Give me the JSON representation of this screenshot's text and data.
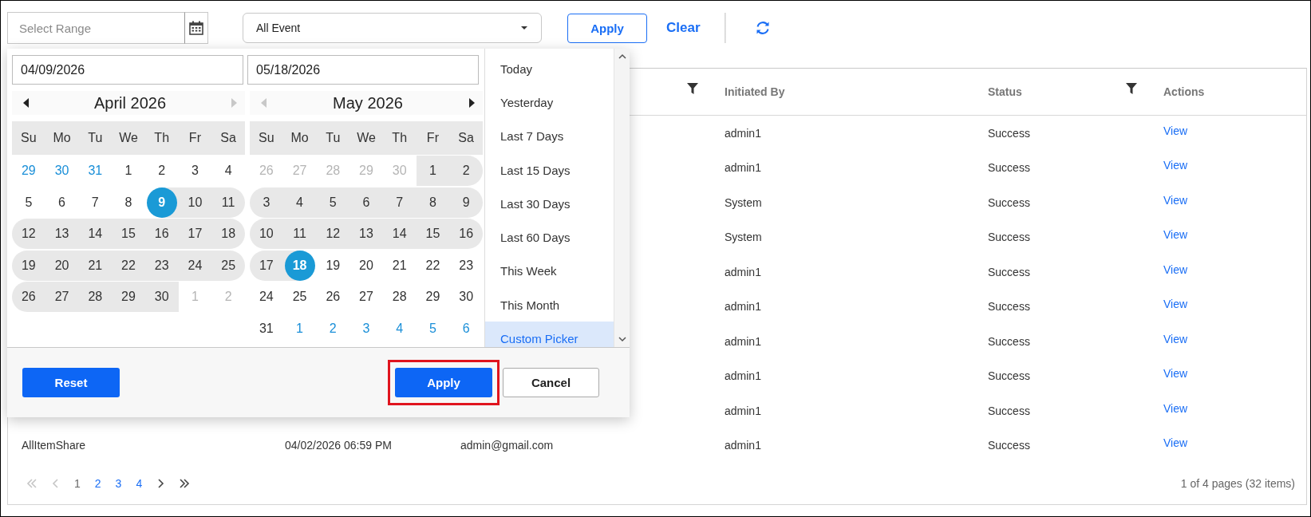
{
  "toolbar": {
    "range_field": {
      "placeholder": "Select Range"
    },
    "event_select": {
      "value": "All Event"
    },
    "apply": "Apply",
    "clear": "Clear"
  },
  "table": {
    "columns": [
      {
        "filter": true
      },
      {
        "label": "Initiated By",
        "filter": false
      },
      {
        "label": "Status",
        "filter": true
      },
      {
        "label": "Actions",
        "filter": false
      }
    ],
    "rows": [
      {
        "initiated_by": "admin1",
        "status": "Success",
        "action": "View"
      },
      {
        "initiated_by": "admin1",
        "status": "Success",
        "action": "View"
      },
      {
        "initiated_by": "System",
        "status": "Success",
        "action": "View"
      },
      {
        "initiated_by": "System",
        "status": "Success",
        "action": "View"
      },
      {
        "initiated_by": "admin1",
        "status": "Success",
        "action": "View"
      },
      {
        "initiated_by": "admin1",
        "status": "Success",
        "action": "View"
      },
      {
        "initiated_by": "admin1",
        "status": "Success",
        "action": "View"
      },
      {
        "initiated_by": "admin1",
        "status": "Success",
        "action": "View"
      },
      {
        "initiated_by": "admin1",
        "status": "Success",
        "action": "View"
      },
      {
        "name": "AllItemShare",
        "date": "04/02/2026 06:59 PM",
        "email": "admin@gmail.com",
        "initiated_by": "admin1",
        "status": "Success",
        "action": "View"
      }
    ],
    "pagination": {
      "first_disabled": true,
      "prev_disabled": true,
      "next_disabled": false,
      "last_disabled": false,
      "pages": [
        {
          "label": "1",
          "selected": true
        },
        {
          "label": "2",
          "selected": false
        },
        {
          "label": "3",
          "selected": false
        },
        {
          "label": "4",
          "selected": false
        }
      ],
      "info": "1 of 4 pages (32 items)"
    }
  },
  "date_picker": {
    "start_value": "04/09/2026",
    "end_value": "05/18/2026",
    "calendars": [
      {
        "title": "April 2026",
        "prev_disabled": false,
        "next_disabled": true,
        "weekdays": [
          "Su",
          "Mo",
          "Tu",
          "We",
          "Th",
          "Fr",
          "Sa"
        ],
        "weeks": [
          [
            {
              "label": "29",
              "other_month": true,
              "disabled": false,
              "in_range": false,
              "selected": false
            },
            {
              "label": "30",
              "other_month": true,
              "disabled": false,
              "in_range": false,
              "selected": false
            },
            {
              "label": "31",
              "other_month": true,
              "disabled": false,
              "in_range": false,
              "selected": false
            },
            {
              "label": "1",
              "other_month": false,
              "disabled": false,
              "in_range": false,
              "selected": false
            },
            {
              "label": "2",
              "other_month": false,
              "disabled": false,
              "in_range": false,
              "selected": false
            },
            {
              "label": "3",
              "other_month": false,
              "disabled": false,
              "in_range": false,
              "selected": false
            },
            {
              "label": "4",
              "other_month": false,
              "disabled": false,
              "in_range": false,
              "selected": false
            }
          ],
          [
            {
              "label": "5",
              "other_month": false,
              "disabled": false,
              "in_range": false,
              "selected": false
            },
            {
              "label": "6",
              "other_month": false,
              "disabled": false,
              "in_range": false,
              "selected": false
            },
            {
              "label": "7",
              "other_month": false,
              "disabled": false,
              "in_range": false,
              "selected": false
            },
            {
              "label": "8",
              "other_month": false,
              "disabled": false,
              "in_range": false,
              "selected": false
            },
            {
              "label": "9",
              "other_month": false,
              "disabled": false,
              "in_range": true,
              "selected": true
            },
            {
              "label": "10",
              "other_month": false,
              "disabled": false,
              "in_range": true,
              "selected": false
            },
            {
              "label": "11",
              "other_month": false,
              "disabled": false,
              "in_range": true,
              "selected": false
            }
          ],
          [
            {
              "label": "12",
              "other_month": false,
              "disabled": false,
              "in_range": true,
              "selected": false
            },
            {
              "label": "13",
              "other_month": false,
              "disabled": false,
              "in_range": true,
              "selected": false
            },
            {
              "label": "14",
              "other_month": false,
              "disabled": false,
              "in_range": true,
              "selected": false
            },
            {
              "label": "15",
              "other_month": false,
              "disabled": false,
              "in_range": true,
              "selected": false
            },
            {
              "label": "16",
              "other_month": false,
              "disabled": false,
              "in_range": true,
              "selected": false
            },
            {
              "label": "17",
              "other_month": false,
              "disabled": false,
              "in_range": true,
              "selected": false
            },
            {
              "label": "18",
              "other_month": false,
              "disabled": false,
              "in_range": true,
              "selected": false
            }
          ],
          [
            {
              "label": "19",
              "other_month": false,
              "disabled": false,
              "in_range": true,
              "selected": false
            },
            {
              "label": "20",
              "other_month": false,
              "disabled": false,
              "in_range": true,
              "selected": false
            },
            {
              "label": "21",
              "other_month": false,
              "disabled": false,
              "in_range": true,
              "selected": false
            },
            {
              "label": "22",
              "other_month": false,
              "disabled": false,
              "in_range": true,
              "selected": false
            },
            {
              "label": "23",
              "other_month": false,
              "disabled": false,
              "in_range": true,
              "selected": false
            },
            {
              "label": "24",
              "other_month": false,
              "disabled": false,
              "in_range": true,
              "selected": false
            },
            {
              "label": "25",
              "other_month": false,
              "disabled": false,
              "in_range": true,
              "selected": false
            }
          ],
          [
            {
              "label": "26",
              "other_month": false,
              "disabled": false,
              "in_range": true,
              "selected": false
            },
            {
              "label": "27",
              "other_month": false,
              "disabled": false,
              "in_range": true,
              "selected": false
            },
            {
              "label": "28",
              "other_month": false,
              "disabled": false,
              "in_range": true,
              "selected": false
            },
            {
              "label": "29",
              "other_month": false,
              "disabled": false,
              "in_range": true,
              "selected": false
            },
            {
              "label": "30",
              "other_month": false,
              "disabled": false,
              "in_range": true,
              "selected": false
            },
            {
              "label": "1",
              "other_month": true,
              "disabled": true,
              "in_range": false,
              "selected": false
            },
            {
              "label": "2",
              "other_month": true,
              "disabled": true,
              "in_range": false,
              "selected": false
            }
          ]
        ]
      },
      {
        "title": "May 2026",
        "prev_disabled": true,
        "next_disabled": false,
        "weekdays": [
          "Su",
          "Mo",
          "Tu",
          "We",
          "Th",
          "Fr",
          "Sa"
        ],
        "weeks": [
          [
            {
              "label": "26",
              "other_month": true,
              "disabled": true,
              "in_range": false,
              "selected": false
            },
            {
              "label": "27",
              "other_month": true,
              "disabled": true,
              "in_range": false,
              "selected": false
            },
            {
              "label": "28",
              "other_month": true,
              "disabled": true,
              "in_range": false,
              "selected": false
            },
            {
              "label": "29",
              "other_month": true,
              "disabled": true,
              "in_range": false,
              "selected": false
            },
            {
              "label": "30",
              "other_month": true,
              "disabled": true,
              "in_range": false,
              "selected": false
            },
            {
              "label": "1",
              "other_month": false,
              "disabled": false,
              "in_range": true,
              "selected": false
            },
            {
              "label": "2",
              "other_month": false,
              "disabled": false,
              "in_range": true,
              "selected": false
            }
          ],
          [
            {
              "label": "3",
              "other_month": false,
              "disabled": false,
              "in_range": true,
              "selected": false
            },
            {
              "label": "4",
              "other_month": false,
              "disabled": false,
              "in_range": true,
              "selected": false
            },
            {
              "label": "5",
              "other_month": false,
              "disabled": false,
              "in_range": true,
              "selected": false
            },
            {
              "label": "6",
              "other_month": false,
              "disabled": false,
              "in_range": true,
              "selected": false
            },
            {
              "label": "7",
              "other_month": false,
              "disabled": false,
              "in_range": true,
              "selected": false
            },
            {
              "label": "8",
              "other_month": false,
              "disabled": false,
              "in_range": true,
              "selected": false
            },
            {
              "label": "9",
              "other_month": false,
              "disabled": false,
              "in_range": true,
              "selected": false
            }
          ],
          [
            {
              "label": "10",
              "other_month": false,
              "disabled": false,
              "in_range": true,
              "selected": false
            },
            {
              "label": "11",
              "other_month": false,
              "disabled": false,
              "in_range": true,
              "selected": false
            },
            {
              "label": "12",
              "other_month": false,
              "disabled": false,
              "in_range": true,
              "selected": false
            },
            {
              "label": "13",
              "other_month": false,
              "disabled": false,
              "in_range": true,
              "selected": false
            },
            {
              "label": "14",
              "other_month": false,
              "disabled": false,
              "in_range": true,
              "selected": false
            },
            {
              "label": "15",
              "other_month": false,
              "disabled": false,
              "in_range": true,
              "selected": false
            },
            {
              "label": "16",
              "other_month": false,
              "disabled": false,
              "in_range": true,
              "selected": false
            }
          ],
          [
            {
              "label": "17",
              "other_month": false,
              "disabled": false,
              "in_range": true,
              "selected": false
            },
            {
              "label": "18",
              "other_month": false,
              "disabled": false,
              "in_range": true,
              "selected": true
            },
            {
              "label": "19",
              "other_month": false,
              "disabled": false,
              "in_range": false,
              "selected": false
            },
            {
              "label": "20",
              "other_month": false,
              "disabled": false,
              "in_range": false,
              "selected": false
            },
            {
              "label": "21",
              "other_month": false,
              "disabled": false,
              "in_range": false,
              "selected": false
            },
            {
              "label": "22",
              "other_month": false,
              "disabled": false,
              "in_range": false,
              "selected": false
            },
            {
              "label": "23",
              "other_month": false,
              "disabled": false,
              "in_range": false,
              "selected": false
            }
          ],
          [
            {
              "label": "24",
              "other_month": false,
              "disabled": false,
              "in_range": false,
              "selected": false
            },
            {
              "label": "25",
              "other_month": false,
              "disabled": false,
              "in_range": false,
              "selected": false
            },
            {
              "label": "26",
              "other_month": false,
              "disabled": false,
              "in_range": false,
              "selected": false
            },
            {
              "label": "27",
              "other_month": false,
              "disabled": false,
              "in_range": false,
              "selected": false
            },
            {
              "label": "28",
              "other_month": false,
              "disabled": false,
              "in_range": false,
              "selected": false
            },
            {
              "label": "29",
              "other_month": false,
              "disabled": false,
              "in_range": false,
              "selected": false
            },
            {
              "label": "30",
              "other_month": false,
              "disabled": false,
              "in_range": false,
              "selected": false
            }
          ],
          [
            {
              "label": "31",
              "other_month": false,
              "disabled": false,
              "in_range": false,
              "selected": false
            },
            {
              "label": "1",
              "other_month": true,
              "disabled": false,
              "in_range": false,
              "selected": false
            },
            {
              "label": "2",
              "other_month": true,
              "disabled": false,
              "in_range": false,
              "selected": false
            },
            {
              "label": "3",
              "other_month": true,
              "disabled": false,
              "in_range": false,
              "selected": false
            },
            {
              "label": "4",
              "other_month": true,
              "disabled": false,
              "in_range": false,
              "selected": false
            },
            {
              "label": "5",
              "other_month": true,
              "disabled": false,
              "in_range": false,
              "selected": false
            },
            {
              "label": "6",
              "other_month": true,
              "disabled": false,
              "in_range": false,
              "selected": false
            }
          ]
        ]
      }
    ],
    "presets": [
      {
        "label": "Today",
        "selected": false
      },
      {
        "label": "Yesterday",
        "selected": false
      },
      {
        "label": "Last 7 Days",
        "selected": false
      },
      {
        "label": "Last 15 Days",
        "selected": false
      },
      {
        "label": "Last 30 Days",
        "selected": false
      },
      {
        "label": "Last 60 Days",
        "selected": false
      },
      {
        "label": "This Week",
        "selected": false
      },
      {
        "label": "This Month",
        "selected": false
      },
      {
        "label": "Custom Picker",
        "selected": true
      }
    ],
    "reset": "Reset",
    "apply": {
      "label": "Apply",
      "highlighted": true
    },
    "cancel": "Cancel"
  }
}
